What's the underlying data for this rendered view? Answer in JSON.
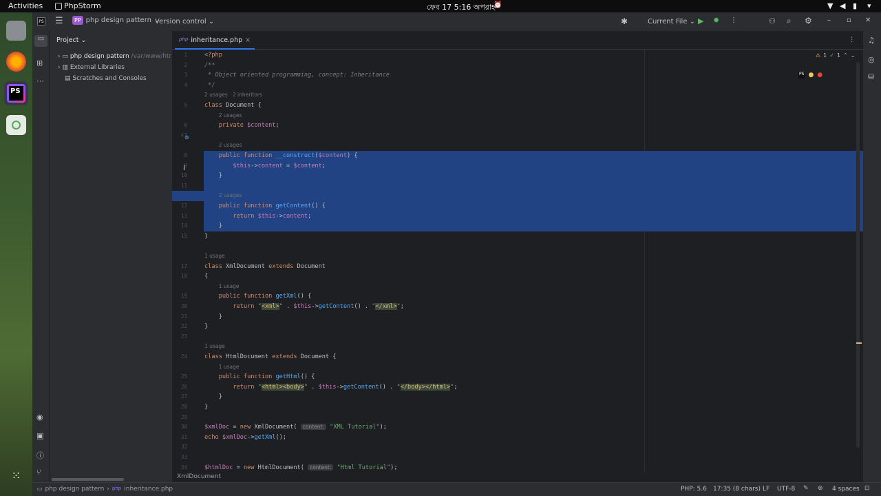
{
  "gnome": {
    "activities": "Activities",
    "app": "PhpStorm",
    "clock": "ফেব 17  5:16 অপরাহ্ন"
  },
  "titlebar": {
    "project_badge": "PP",
    "project": "php design pattern",
    "vcs": "Version control",
    "run_config": "Current File"
  },
  "project_panel": {
    "title": "Project",
    "items": [
      {
        "label": "php design pattern",
        "path": "/var/www/htr"
      },
      {
        "label": "External Libraries"
      },
      {
        "label": "Scratches and Consoles"
      }
    ]
  },
  "tab": {
    "label": "inheritance.php",
    "prefix": "php"
  },
  "inspection": {
    "warnings": "1",
    "ok": "1"
  },
  "code_lines": [
    {
      "n": "1",
      "html": "<span class='kw'>&lt;?php</span>"
    },
    {
      "n": "2",
      "html": "<span class='cm'>/**</span>"
    },
    {
      "n": "3",
      "html": "<span class='cm'> * Object oriented programming, concept: Inheritance</span>"
    },
    {
      "n": "4",
      "html": "<span class='cm'> */</span>"
    },
    {
      "n": "",
      "html": "<span class='hint'>2 usages   2 inheritors</span>"
    },
    {
      "n": "5",
      "html": "<span class='kw'>class</span> Document {"
    },
    {
      "n": "",
      "html": "    <span class='hint'>2 usages</span>"
    },
    {
      "n": "6",
      "html": "    <span class='kw'>private</span> <span class='var'>$content</span>;"
    },
    {
      "n": "7",
      "html": ""
    },
    {
      "n": "",
      "html": "    <span class='hint'>2 usages</span>"
    },
    {
      "n": "8",
      "html": "    <span class='kw'>public function</span> <span class='fn'>__construct</span>(<span class='var'>$content</span>) {",
      "sel": true
    },
    {
      "n": "9",
      "html": "        <span class='var'>$this</span>-&gt;<span class='var'>content</span> = <span class='var'>$content</span>;",
      "sel": true
    },
    {
      "n": "10",
      "html": "    }",
      "sel": true
    },
    {
      "n": "11",
      "html": "",
      "sel": true
    },
    {
      "n": "",
      "html": "    <span class='hint'>2 usages</span>",
      "sel": true
    },
    {
      "n": "12",
      "html": "    <span class='kw'>public function</span> <span class='fn'>getContent</span>() {",
      "sel": true
    },
    {
      "n": "13",
      "html": "        <span class='kw'>return</span> <span class='var'>$this</span>-&gt;<span class='var'>content</span>;",
      "sel": true
    },
    {
      "n": "14",
      "html": "    }",
      "sel": true
    },
    {
      "n": "15",
      "html": "}"
    },
    {
      "n": "",
      "html": ""
    },
    {
      "n": "",
      "html": "<span class='hint'>1 usage</span>"
    },
    {
      "n": "17",
      "html": "<span class='kw'>class</span> XmlDocument <span class='kw'>extends</span> Document"
    },
    {
      "n": "18",
      "html": "{"
    },
    {
      "n": "",
      "html": "    <span class='hint'>1 usage</span>"
    },
    {
      "n": "19",
      "html": "    <span class='kw'>public function</span> <span class='fn'>getXml</span>() {"
    },
    {
      "n": "20",
      "html": "        <span class='kw'>return</span> <span class='str'>\"<span class='tag'>&lt;xml&gt;</span>\"</span> . <span class='var'>$this</span>-&gt;<span class='fn'>getContent</span>() . <span class='str'>\"<span class='tag'>&lt;/xml&gt;</span>\"</span>;"
    },
    {
      "n": "21",
      "html": "    }"
    },
    {
      "n": "22",
      "html": "}"
    },
    {
      "n": "23",
      "html": ""
    },
    {
      "n": "",
      "html": "<span class='hint'>1 usage</span>"
    },
    {
      "n": "24",
      "html": "<span class='kw'>class</span> HtmlDocument <span class='kw'>extends</span> Document {"
    },
    {
      "n": "",
      "html": "    <span class='hint'>1 usage</span>"
    },
    {
      "n": "25",
      "html": "    <span class='kw'>public function</span> <span class='fn'>getHtml</span>() {"
    },
    {
      "n": "26",
      "html": "        <span class='kw'>return</span> <span class='str'>\"<span class='tag'>&lt;html&gt;&lt;body&gt;</span>\"</span> . <span class='var'>$this</span>-&gt;<span class='fn'>getContent</span>() . <span class='str'>\"<span class='tag'>&lt;/body&gt;&lt;/html&gt;</span>\"</span>;"
    },
    {
      "n": "27",
      "html": "    }"
    },
    {
      "n": "28",
      "html": "}"
    },
    {
      "n": "29",
      "html": ""
    },
    {
      "n": "30",
      "html": "<span class='var'>$xmlDoc</span> = <span class='kw'>new</span> XmlDocument( <span class='inlay'>content:</span> <span class='str'>\"XML Tutorial\"</span>);"
    },
    {
      "n": "31",
      "html": "<span class='kw'>echo</span> <span class='var'>$xmlDoc</span>-&gt;<span class='fn'>getXml</span>();"
    },
    {
      "n": "32",
      "html": ""
    },
    {
      "n": "33",
      "html": ""
    },
    {
      "n": "34",
      "html": "<span class='var'>$htmlDoc</span> = <span class='kw'>new</span> HtmlDocument( <span class='inlay'>content:</span> <span class='str'>\"Html Tutorial\"</span>);"
    }
  ],
  "breadcrumb_code": "XmlDocument",
  "status": {
    "crumb1": "php design pattern",
    "crumb2": "inheritance.php",
    "php": "PHP: 5.6",
    "pos": "17:35 (8 chars)",
    "le": "LF",
    "enc": "UTF-8",
    "indent": "4 spaces"
  },
  "colors": {
    "selection": "#214283",
    "keyword": "#cf8e6d",
    "variable": "#c77dbb",
    "function": "#56a8f5",
    "string": "#6aab73"
  }
}
